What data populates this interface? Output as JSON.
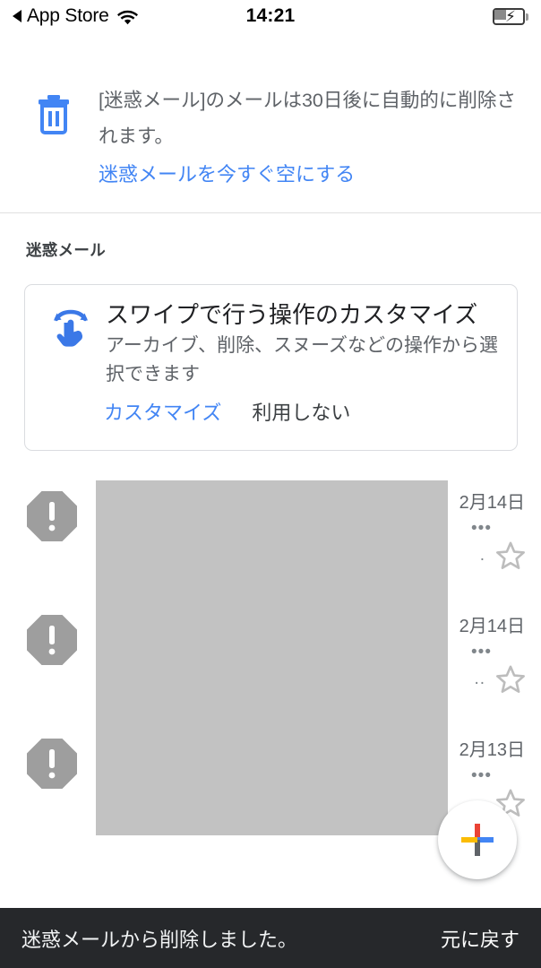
{
  "status_bar": {
    "back_label": "App Store",
    "back_arrow_icon": "triangle-left-icon",
    "wifi_icon": "wifi-icon",
    "time": "14:21",
    "battery_icon": "battery-charging-icon"
  },
  "banner": {
    "icon": "trash-icon",
    "message": "[迷惑メール]のメールは30日後に自動的に削除されます。",
    "link_label": "迷惑メールを今すぐ空にする",
    "link_color": "#4285f4"
  },
  "section": {
    "label": "迷惑メール"
  },
  "promo_card": {
    "icon": "swipe-gesture-icon",
    "title": "スワイプで行う操作のカスタマイズ",
    "body": "アーカイブ、削除、スヌーズなどの操作から選択できます",
    "primary_action": "カスタマイズ",
    "secondary_action": "利用しない",
    "primary_color": "#4285f4"
  },
  "mail_rows": [
    {
      "avatar_icon": "spam-warning-octagon-icon",
      "date": "2月14日",
      "overflow_icon": "ellipsis-icon",
      "snippet_dots": ".",
      "star_icon": "star-outline-icon"
    },
    {
      "avatar_icon": "spam-warning-octagon-icon",
      "date": "2月14日",
      "overflow_icon": "ellipsis-icon",
      "snippet_dots": "..",
      "star_icon": "star-outline-icon"
    },
    {
      "avatar_icon": "spam-warning-octagon-icon",
      "date": "2月13日",
      "overflow_icon": "ellipsis-icon",
      "snippet_dots": "..",
      "star_icon": "star-outline-icon"
    }
  ],
  "redaction": {
    "color": "#c2c2c2"
  },
  "fab": {
    "icon": "compose-plus-icon",
    "colors": {
      "top": "#ea4335",
      "right": "#4285f4",
      "bottom": "#5f6368",
      "left": "#fbbc04"
    }
  },
  "snackbar": {
    "message": "迷惑メールから削除しました。",
    "action_label": "元に戻す",
    "background": "#26282b"
  }
}
